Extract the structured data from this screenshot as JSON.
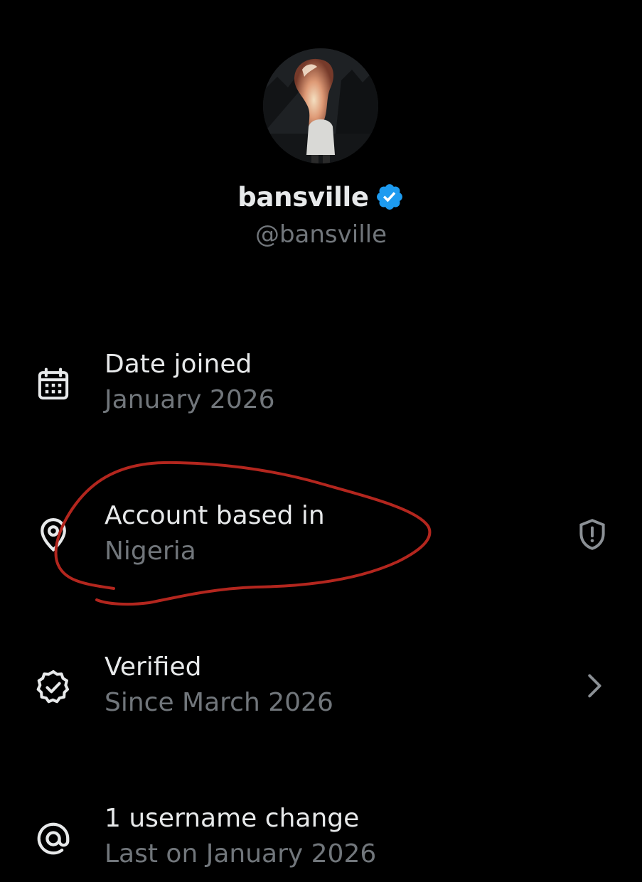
{
  "profile": {
    "display_name": "bansville",
    "handle": "@bansville"
  },
  "icons": {
    "verified_badge": "verified-badge-icon",
    "calendar": "calendar-icon",
    "location": "location-pin-icon",
    "shield": "shield-alert-icon",
    "verified": "verified-check-icon",
    "chevron": "chevron-right-icon",
    "at": "at-sign-icon"
  },
  "colors": {
    "background": "#000000",
    "primary_text": "#e7e9ea",
    "secondary_text": "#71767b",
    "verified_blue": "#1d9bf0",
    "annotation_red": "#b3261e"
  },
  "details": {
    "date_joined": {
      "title": "Date joined",
      "value": "January 2026"
    },
    "account_based": {
      "title": "Account based in",
      "value": "Nigeria"
    },
    "verified": {
      "title": "Verified",
      "value": "Since March 2026"
    },
    "username_changes": {
      "title": "1 username change",
      "value": "Last on January 2026"
    }
  }
}
